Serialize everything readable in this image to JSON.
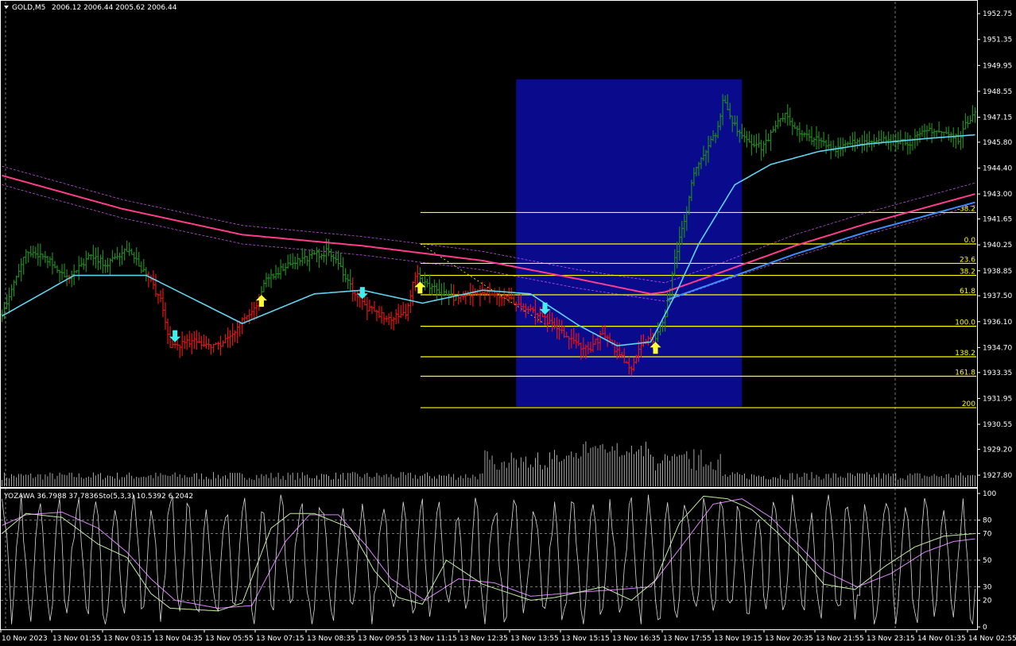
{
  "header": {
    "symbol": "GOLD,M5",
    "ohlc": "2006.12 2006.44 2005.62 2006.44"
  },
  "indicator_header": {
    "yozawa": "YOZAWA 36.7988 37.7836",
    "sto": "Sto(5,3,3) 10.5392 6.2042"
  },
  "colors": {
    "up_bar": "#1e8a1e",
    "down_bar": "#e31414",
    "ma_fast": "#5fd3f0",
    "ma_slow": "#ff3c8c",
    "ma_mid": "#3c8cff",
    "band": "#c050e0",
    "fib": "#ffff00",
    "box": "#0a0a8c",
    "arrow_up": "#ffff3c",
    "arrow_down": "#3cf0f0",
    "stoch_main": "#c0f0a0",
    "stoch_signal": "#e080ff",
    "yozawa": "#d8d8d8",
    "grid": "#777777"
  },
  "chart_data": [
    {
      "type": "candlestick",
      "name": "main",
      "ylim": [
        1927.2,
        1953.4
      ],
      "y_ticks": [
        "1952.75",
        "1951.35",
        "1949.95",
        "1948.55",
        "1947.15",
        "1945.80",
        "1944.40",
        "1943.00",
        "1941.65",
        "1940.25",
        "1938.85",
        "1937.50",
        "1936.10",
        "1934.70",
        "1933.35",
        "1931.95",
        "1930.55",
        "1929.20",
        "1927.80"
      ],
      "x_ticks": [
        "10 Nov 2023",
        "13 Nov 01:55",
        "13 Nov 03:15",
        "13 Nov 04:35",
        "13 Nov 05:55",
        "13 Nov 07:15",
        "13 Nov 08:35",
        "13 Nov 09:55",
        "13 Nov 11:15",
        "13 Nov 12:35",
        "13 Nov 13:55",
        "13 Nov 15:15",
        "13 Nov 16:35",
        "13 Nov 17:55",
        "13 Nov 19:15",
        "13 Nov 20:35",
        "13 Nov 21:55",
        "13 Nov 23:15",
        "14 Nov 01:35",
        "14 Nov 02:55"
      ],
      "close_waypoints": [
        [
          0,
          1936.6
        ],
        [
          5,
          1938.1
        ],
        [
          10,
          1940.0
        ],
        [
          18,
          1939.6
        ],
        [
          28,
          1938.4
        ],
        [
          36,
          1939.6
        ],
        [
          44,
          1939.2
        ],
        [
          52,
          1940.0
        ],
        [
          58,
          1939.0
        ],
        [
          62,
          1938.3
        ],
        [
          66,
          1937.2
        ],
        [
          70,
          1934.8
        ],
        [
          80,
          1935.0
        ],
        [
          90,
          1934.8
        ],
        [
          96,
          1935.5
        ],
        [
          100,
          1936.2
        ],
        [
          106,
          1936.8
        ],
        [
          110,
          1938.4
        ],
        [
          120,
          1939.3
        ],
        [
          128,
          1939.6
        ],
        [
          136,
          1939.9
        ],
        [
          142,
          1938.8
        ],
        [
          146,
          1937.8
        ],
        [
          152,
          1936.8
        ],
        [
          162,
          1936.2
        ],
        [
          168,
          1936.6
        ],
        [
          172,
          1938.6
        ],
        [
          180,
          1937.9
        ],
        [
          190,
          1937.3
        ],
        [
          200,
          1937.8
        ],
        [
          210,
          1937.4
        ],
        [
          218,
          1936.8
        ],
        [
          224,
          1936.4
        ],
        [
          230,
          1935.8
        ],
        [
          238,
          1935.0
        ],
        [
          244,
          1934.6
        ],
        [
          250,
          1935.4
        ],
        [
          256,
          1934.5
        ],
        [
          262,
          1933.6
        ],
        [
          266,
          1935.0
        ],
        [
          272,
          1935.2
        ],
        [
          276,
          1936.5
        ],
        [
          280,
          1939.5
        ],
        [
          284,
          1941.5
        ],
        [
          288,
          1944.2
        ],
        [
          294,
          1945.7
        ],
        [
          298,
          1946.5
        ],
        [
          300,
          1948.2
        ],
        [
          304,
          1946.8
        ],
        [
          310,
          1946.0
        ],
        [
          316,
          1945.5
        ],
        [
          320,
          1946.2
        ],
        [
          326,
          1947.4
        ],
        [
          332,
          1946.2
        ],
        [
          338,
          1946.0
        ],
        [
          346,
          1945.4
        ],
        [
          354,
          1945.9
        ],
        [
          362,
          1945.7
        ],
        [
          370,
          1946.0
        ],
        [
          378,
          1945.8
        ],
        [
          386,
          1946.5
        ],
        [
          392,
          1946.3
        ],
        [
          398,
          1946.0
        ],
        [
          405,
          1947.6
        ]
      ],
      "series": [
        {
          "name": "MA fast",
          "waypoints": [
            [
              0,
              1936.4
            ],
            [
              30,
              1938.6
            ],
            [
              60,
              1938.6
            ],
            [
              100,
              1936.0
            ],
            [
              130,
              1937.6
            ],
            [
              150,
              1937.8
            ],
            [
              175,
              1937.1
            ],
            [
              200,
              1937.8
            ],
            [
              220,
              1937.6
            ],
            [
              240,
              1935.9
            ],
            [
              256,
              1934.8
            ],
            [
              270,
              1935.0
            ],
            [
              280,
              1937.5
            ],
            [
              290,
              1940.3
            ],
            [
              305,
              1943.5
            ],
            [
              320,
              1944.6
            ],
            [
              340,
              1945.3
            ],
            [
              360,
              1945.7
            ],
            [
              385,
              1946.0
            ],
            [
              405,
              1946.2
            ]
          ]
        },
        {
          "name": "MA slow",
          "waypoints": [
            [
              0,
              1944.0
            ],
            [
              50,
              1942.2
            ],
            [
              100,
              1940.8
            ],
            [
              150,
              1940.2
            ],
            [
              200,
              1939.4
            ],
            [
              240,
              1938.4
            ],
            [
              270,
              1937.6
            ],
            [
              276,
              1937.7
            ],
            [
              300,
              1938.8
            ],
            [
              330,
              1940.2
            ],
            [
              360,
              1941.4
            ],
            [
              405,
              1943.0
            ]
          ]
        },
        {
          "name": "band upper",
          "waypoints": [
            [
              0,
              1944.5
            ],
            [
              50,
              1942.7
            ],
            [
              100,
              1941.3
            ],
            [
              150,
              1940.7
            ],
            [
              200,
              1939.9
            ],
            [
              240,
              1938.9
            ],
            [
              276,
              1938.2
            ],
            [
              300,
              1939.3
            ],
            [
              330,
              1940.8
            ],
            [
              360,
              1942.0
            ],
            [
              405,
              1943.6
            ]
          ]
        },
        {
          "name": "band lower",
          "waypoints": [
            [
              0,
              1943.5
            ],
            [
              50,
              1941.7
            ],
            [
              100,
              1940.3
            ],
            [
              150,
              1939.7
            ],
            [
              200,
              1938.9
            ],
            [
              240,
              1937.9
            ],
            [
              276,
              1937.2
            ],
            [
              300,
              1938.3
            ],
            [
              330,
              1939.6
            ],
            [
              360,
              1940.8
            ],
            [
              405,
              1942.4
            ]
          ]
        }
      ],
      "fib_levels": [
        {
          "label": "-38.2",
          "price": 1942.0
        },
        {
          "label": "0.0",
          "price": 1940.3
        },
        {
          "label": "23.6",
          "price": 1939.25
        },
        {
          "label": "38.2",
          "price": 1938.6
        },
        {
          "label": "61.8",
          "price": 1937.55
        },
        {
          "label": "100.0",
          "price": 1935.85
        },
        {
          "label": "138.2",
          "price": 1934.2
        },
        {
          "label": "161.8",
          "price": 1933.15
        },
        {
          "label": "200",
          "price": 1931.45
        }
      ],
      "box": {
        "start_bar": 214,
        "end_bar": 308,
        "top": 1949.2,
        "bottom": 1931.5
      },
      "arrows": [
        {
          "bar": 72,
          "dir": "down"
        },
        {
          "bar": 108,
          "dir": "up"
        },
        {
          "bar": 150,
          "dir": "down"
        },
        {
          "bar": 174,
          "dir": "up"
        },
        {
          "bar": 226,
          "dir": "down"
        },
        {
          "bar": 272,
          "dir": "up"
        }
      ]
    },
    {
      "type": "line",
      "name": "oscillator",
      "ylim": [
        0,
        100
      ],
      "y_ticks": [
        "100",
        "80",
        "70",
        "50",
        "30",
        "20",
        "0"
      ],
      "levels": [
        80,
        70,
        50,
        30,
        20
      ],
      "main_waypoints": [
        [
          0,
          70
        ],
        [
          10,
          85
        ],
        [
          25,
          82
        ],
        [
          40,
          62
        ],
        [
          52,
          52
        ],
        [
          62,
          25
        ],
        [
          70,
          14
        ],
        [
          90,
          12
        ],
        [
          100,
          18
        ],
        [
          112,
          74
        ],
        [
          120,
          85
        ],
        [
          130,
          85
        ],
        [
          145,
          74
        ],
        [
          155,
          42
        ],
        [
          165,
          22
        ],
        [
          175,
          17
        ],
        [
          185,
          50
        ],
        [
          200,
          32
        ],
        [
          210,
          26
        ],
        [
          220,
          20
        ],
        [
          230,
          22
        ],
        [
          250,
          30
        ],
        [
          262,
          20
        ],
        [
          272,
          35
        ],
        [
          282,
          78
        ],
        [
          292,
          98
        ],
        [
          302,
          96
        ],
        [
          312,
          88
        ],
        [
          322,
          72
        ],
        [
          332,
          54
        ],
        [
          342,
          32
        ],
        [
          355,
          28
        ],
        [
          368,
          46
        ],
        [
          380,
          60
        ],
        [
          392,
          68
        ],
        [
          405,
          70
        ]
      ],
      "signal_waypoints": [
        [
          0,
          76
        ],
        [
          10,
          84
        ],
        [
          25,
          86
        ],
        [
          40,
          74
        ],
        [
          52,
          56
        ],
        [
          62,
          36
        ],
        [
          72,
          20
        ],
        [
          90,
          14
        ],
        [
          104,
          16
        ],
        [
          118,
          64
        ],
        [
          128,
          84
        ],
        [
          140,
          84
        ],
        [
          152,
          60
        ],
        [
          162,
          36
        ],
        [
          176,
          20
        ],
        [
          190,
          36
        ],
        [
          205,
          33
        ],
        [
          220,
          23
        ],
        [
          240,
          26
        ],
        [
          256,
          28
        ],
        [
          270,
          30
        ],
        [
          286,
          68
        ],
        [
          296,
          92
        ],
        [
          308,
          96
        ],
        [
          320,
          82
        ],
        [
          330,
          64
        ],
        [
          342,
          42
        ],
        [
          356,
          30
        ],
        [
          370,
          40
        ],
        [
          384,
          56
        ],
        [
          396,
          64
        ],
        [
          405,
          66
        ]
      ]
    }
  ]
}
